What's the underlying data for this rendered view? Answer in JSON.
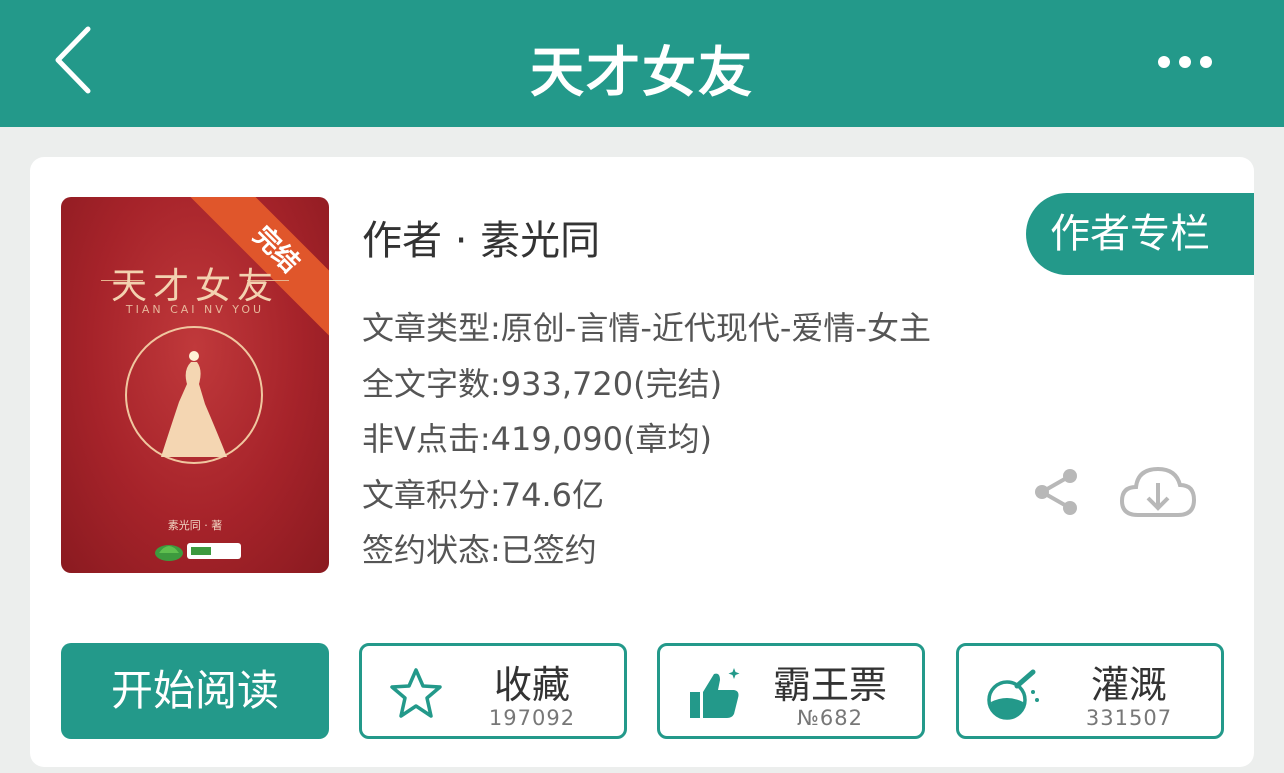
{
  "header": {
    "title": "天才女友",
    "back_icon": "chevron-left-icon",
    "more_icon": "more-dots-icon",
    "color": "#23998a"
  },
  "book": {
    "cover": {
      "badge": "完结",
      "title": "天才女友",
      "pinyin": "TIAN CAI NV YOU",
      "author_line": "素光同 · 著",
      "colors": {
        "background": "#a6232a",
        "ribbon": "#e0562b",
        "gold": "#f3d2b0"
      }
    },
    "author": "作者 · 素光同",
    "author_column_label": "作者专栏",
    "info": {
      "genre": "文章类型:原创-言情-近代现代-爱情-女主",
      "word_count": "全文字数:933,720(完结)",
      "clicks": "非V点击:419,090(章均)",
      "score": "文章积分:74.6亿",
      "sign_status": "签约状态:已签约"
    },
    "share_icon": "share-icon",
    "download_icon": "cloud-download-icon"
  },
  "actions": {
    "read_label": "开始阅读",
    "favorite": {
      "label": "收藏",
      "count": "197092",
      "icon": "star-outline-icon"
    },
    "ticket": {
      "label": "霸王票",
      "count": "№682",
      "icon": "thumbs-up-icon"
    },
    "water": {
      "label": "灌溉",
      "count": "331507",
      "icon": "flask-icon"
    }
  }
}
